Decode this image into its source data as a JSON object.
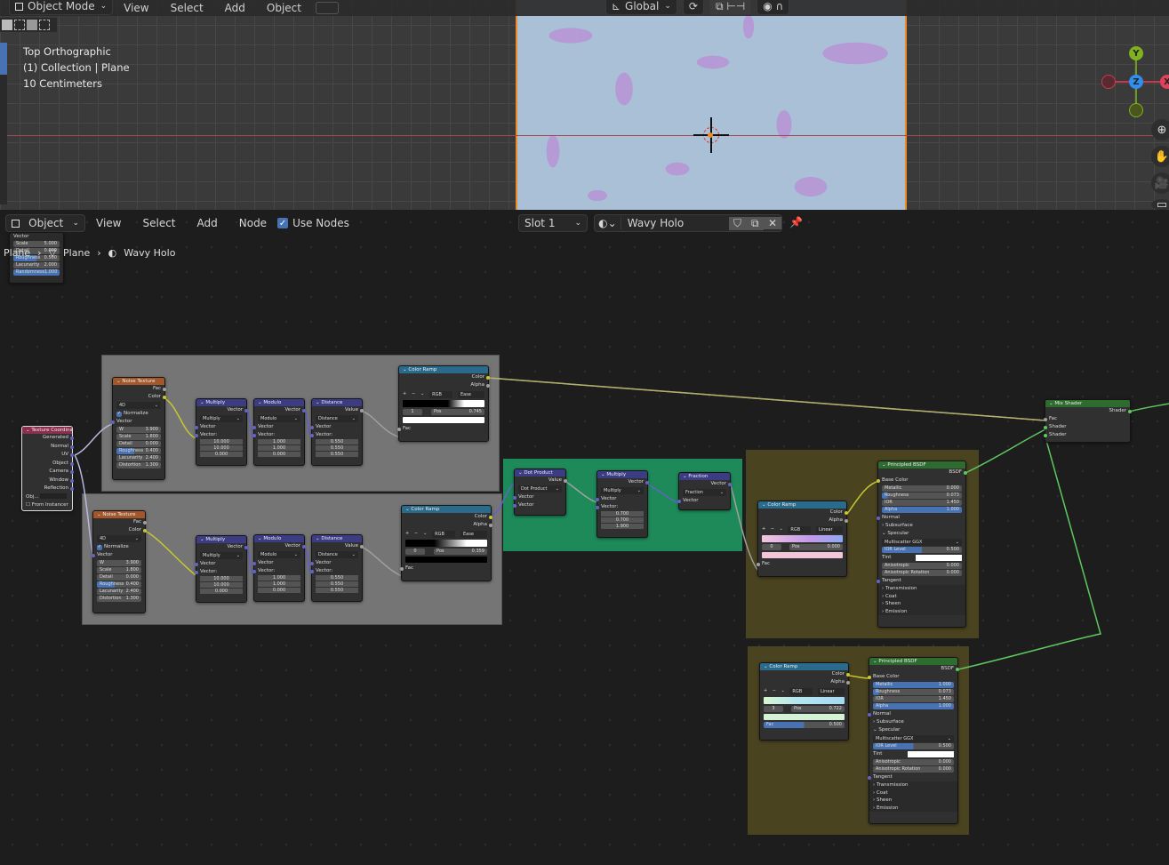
{
  "viewport": {
    "header": {
      "mode": "Object Mode",
      "menus": [
        "View",
        "Select",
        "Add",
        "Object"
      ],
      "orientation": "Global"
    },
    "info": {
      "view": "Top Orthographic",
      "collection": "(1) Collection | Plane",
      "scale": "10 Centimeters"
    },
    "gizmo": {
      "y": "Y",
      "z": "Z",
      "x": "X"
    },
    "colors": {
      "plane_base": "#a9c0d6",
      "plane_pattern": "#b59ad5",
      "selection": "#f08a24"
    }
  },
  "node_editor": {
    "header": {
      "object_type": "Object",
      "menus": [
        "View",
        "Select",
        "Add",
        "Node"
      ],
      "use_nodes_label": "Use Nodes",
      "use_nodes": true,
      "slot": "Slot 1",
      "material": "Wavy Holo"
    },
    "breadcrumb": {
      "root": "Plane",
      "object": "Plane",
      "material": "Wavy Holo"
    },
    "mini_node": {
      "rows": [
        {
          "label": "Vector"
        },
        {
          "label": "Scale",
          "value": "5.000"
        },
        {
          "label": "Detail",
          "value": "0.000"
        },
        {
          "label": "Roughness",
          "value": "0.500"
        },
        {
          "label": "Lacunarity",
          "value": "2.000"
        },
        {
          "label": "Randomness",
          "value": "1.000"
        }
      ]
    },
    "tex_coord": {
      "title": "Texture Coordinate",
      "outputs": [
        "Generated",
        "Normal",
        "UV",
        "Object",
        "Camera",
        "Window",
        "Reflection"
      ],
      "object_label": "Obj...",
      "from_instancer": "From Instancer"
    },
    "noise1": {
      "title": "Noise Texture",
      "outputs": [
        "Fac",
        "Color"
      ],
      "dims": "4D",
      "normalize": "Normalize",
      "input": "Vector",
      "fields": [
        {
          "label": "W",
          "value": "3.900"
        },
        {
          "label": "Scale",
          "value": "1.800"
        },
        {
          "label": "Detail",
          "value": "0.000"
        },
        {
          "label": "Roughness",
          "value": "0.400"
        },
        {
          "label": "Lacunarity",
          "value": "2.400"
        },
        {
          "label": "Distortion",
          "value": "1.300"
        }
      ]
    },
    "noise2": {
      "title": "Noise Texture",
      "outputs": [
        "Fac",
        "Color"
      ],
      "dims": "4D",
      "normalize": "Normalize",
      "input": "Vector",
      "fields": [
        {
          "label": "W",
          "value": "3.900"
        },
        {
          "label": "Scale",
          "value": "1.800"
        },
        {
          "label": "Detail",
          "value": "0.000"
        },
        {
          "label": "Roughness",
          "value": "0.400"
        },
        {
          "label": "Lacunarity",
          "value": "2.400"
        },
        {
          "label": "Distortion",
          "value": "1.300"
        }
      ]
    },
    "mult1": {
      "title": "Multiply",
      "out": "Vector",
      "op": "Multiply",
      "in1": "Vector",
      "in2": "Vector:",
      "vals": [
        "10.000",
        "10.000",
        "0.000"
      ]
    },
    "mod1": {
      "title": "Modulo",
      "out": "Vector",
      "op": "Modulo",
      "in1": "Vector",
      "in2": "Vector:",
      "vals": [
        "1.000",
        "1.000",
        "0.000"
      ]
    },
    "dist1": {
      "title": "Distance",
      "out": "Value",
      "op": "Distance",
      "in1": "Vector",
      "in2": "Vector:",
      "vals": [
        "0.550",
        "0.550",
        "0.550"
      ]
    },
    "mult2": {
      "title": "Multiply",
      "out": "Vector",
      "op": "Multiply",
      "in1": "Vector",
      "in2": "Vector:",
      "vals": [
        "10.000",
        "10.000",
        "0.000"
      ]
    },
    "mod2": {
      "title": "Modulo",
      "out": "Vector",
      "op": "Modulo",
      "in1": "Vector",
      "in2": "Vector:",
      "vals": [
        "1.000",
        "1.000",
        "0.000"
      ]
    },
    "dist2": {
      "title": "Distance",
      "out": "Value",
      "op": "Distance",
      "in1": "Vector",
      "in2": "Vector:",
      "vals": [
        "0.550",
        "0.550",
        "0.550"
      ]
    },
    "ramp1": {
      "title": "Color Ramp",
      "outputs": [
        "Color",
        "Alpha"
      ],
      "mode": "RGB",
      "interp": "Ease",
      "index": "1",
      "pos_label": "Pos",
      "pos": "0.745",
      "input": "Fac"
    },
    "ramp2": {
      "title": "Color Ramp",
      "outputs": [
        "Color",
        "Alpha"
      ],
      "mode": "RGB",
      "interp": "Ease",
      "index": "0",
      "pos_label": "Pos",
      "pos": "0.359",
      "input": "Fac"
    },
    "dot": {
      "title": "Dot Product",
      "out": "Value",
      "op": "Dot Product",
      "in1": "Vector",
      "in2": "Vector"
    },
    "mult3": {
      "title": "Multiply",
      "out": "Vector",
      "op": "Multiply",
      "in1": "Vector",
      "in2": "Vector:",
      "vals": [
        "0.700",
        "0.700",
        "1.900"
      ]
    },
    "frac": {
      "title": "Fraction",
      "out": "Vector",
      "op": "Fraction",
      "in1": "Vector"
    },
    "ramp3": {
      "title": "Color Ramp",
      "outputs": [
        "Color",
        "Alpha"
      ],
      "mode": "RGB",
      "interp": "Linear",
      "index": "0",
      "pos_label": "Pos",
      "pos": "0.000",
      "input": "Fac"
    },
    "ramp4": {
      "title": "Color Ramp",
      "outputs": [
        "Color",
        "Alpha"
      ],
      "mode": "RGB",
      "interp": "Linear",
      "index": "3",
      "pos_label": "Pos",
      "pos": "0.722",
      "input": "Fac",
      "fac": "0.500"
    },
    "bsdf1": {
      "title": "Principled BSDF",
      "out": "BSDF",
      "base": "Base Color",
      "fields": [
        {
          "label": "Metallic",
          "value": "0.000"
        },
        {
          "label": "Roughness",
          "value": "0.073"
        },
        {
          "label": "IOR",
          "value": "1.450"
        },
        {
          "label": "Alpha",
          "value": "1.000"
        }
      ],
      "normal": "Normal",
      "subsurface": "Subsurface",
      "specular": "Specular",
      "dist": "Multiscatter GGX",
      "ior_level": {
        "label": "IOR Level",
        "value": "0.500"
      },
      "tint": "Tint",
      "aniso": {
        "label": "Anisotropic",
        "value": "0.000"
      },
      "aniso_rot": {
        "label": "Anisotropic Rotation",
        "value": "0.000"
      },
      "tangent": "Tangent",
      "panels": [
        "Transmission",
        "Coat",
        "Sheen",
        "Emission"
      ]
    },
    "bsdf2": {
      "title": "Principled BSDF",
      "out": "BSDF",
      "base": "Base Color",
      "fields": [
        {
          "label": "Metallic",
          "value": "1.000"
        },
        {
          "label": "Roughness",
          "value": "0.073"
        },
        {
          "label": "IOR",
          "value": "1.450"
        },
        {
          "label": "Alpha",
          "value": "1.000"
        }
      ],
      "normal": "Normal",
      "subsurface": "Subsurface",
      "specular": "Specular",
      "dist": "Multiscatter GGX",
      "ior_level": {
        "label": "IOR Level",
        "value": "0.500"
      },
      "tint": "Tint",
      "aniso": {
        "label": "Anisotropic",
        "value": "0.000"
      },
      "aniso_rot": {
        "label": "Anisotropic Rotation",
        "value": "0.000"
      },
      "tangent": "Tangent",
      "panels": [
        "Transmission",
        "Coat",
        "Sheen",
        "Emission"
      ]
    },
    "mix": {
      "title": "Mix Shader",
      "out": "Shader",
      "in": [
        "Fac",
        "Shader",
        "Shader"
      ]
    },
    "frame_colors": {
      "gray": "#757575",
      "green": "#1e8a5a",
      "olive": "#4a4320"
    }
  }
}
